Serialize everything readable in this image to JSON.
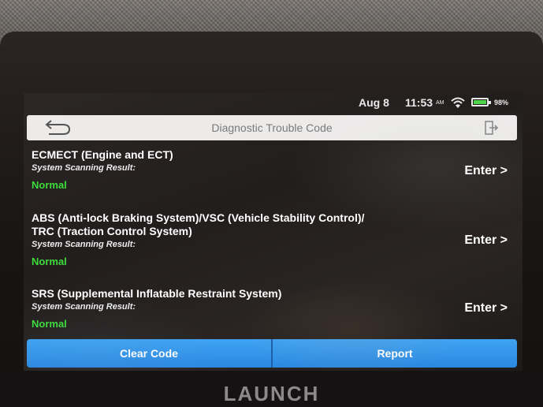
{
  "status_bar": {
    "date": "Aug 8",
    "time": "11:53",
    "ampm": "AM",
    "wifi_icon": "wifi-icon",
    "battery_percent": "98%",
    "battery_level": 0.98
  },
  "header": {
    "back_icon": "back-arrow-icon",
    "title": "Diagnostic Trouble Code",
    "exit_icon": "exit-icon"
  },
  "systems": [
    {
      "name_lines": [
        "ECMECT (Engine and ECT)"
      ],
      "result_label": "System Scanning Result:",
      "result": "Normal",
      "action": "Enter >"
    },
    {
      "name_lines": [
        "ABS (Anti-lock Braking System)/VSC (Vehicle Stability Control)/",
        "TRC (Traction Control System)"
      ],
      "result_label": "System Scanning Result:",
      "result": "Normal",
      "action": "Enter >"
    },
    {
      "name_lines": [
        "SRS (Supplemental Inflatable Restraint System)"
      ],
      "result_label": "System Scanning Result:",
      "result": "Normal",
      "action": "Enter >"
    }
  ],
  "footer": {
    "clear_code_label": "Clear Code",
    "report_label": "Report"
  },
  "device_brand": "LAUNCH",
  "colors": {
    "accent_blue": "#3a9cf0",
    "status_normal": "#3ddc3b",
    "title_bar": "#ecebea"
  }
}
